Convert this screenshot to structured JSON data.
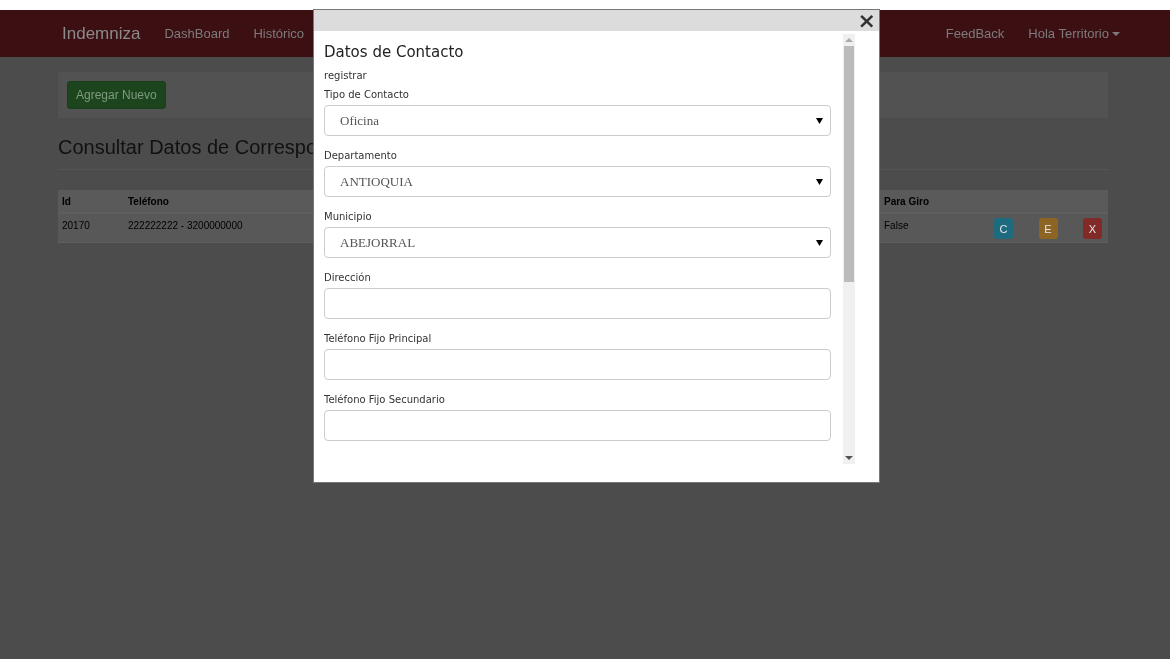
{
  "navbar": {
    "brand": "Indemniza",
    "links": [
      {
        "label": "DashBoard"
      },
      {
        "label": "Histórico"
      }
    ],
    "right_links": [
      {
        "label": "FeedBack",
        "kind": "link"
      },
      {
        "label": "Hola Territorio",
        "kind": "dropdown"
      }
    ]
  },
  "toolbar": {
    "button": "Agregar Nuevo"
  },
  "page_title": "Consultar Datos de Correspo",
  "table": {
    "columns": [
      "Id",
      "Teléfono",
      "Para Giro"
    ],
    "rows": [
      {
        "id": "20170",
        "telefono": "222222222 - 3200000000",
        "para_giro": "False",
        "actions": [
          {
            "label": "C",
            "color": "#1e6b80"
          },
          {
            "label": "E",
            "color": "#8c6424"
          },
          {
            "label": "X",
            "color": "#812a28"
          }
        ]
      }
    ]
  },
  "modal": {
    "close": "×",
    "title": "Datos de Contacto",
    "subtitle": "registrar",
    "fields": [
      {
        "kind": "select",
        "label": "Tipo de Contacto",
        "value": "Oficina"
      },
      {
        "kind": "select",
        "label": "Departamento",
        "value": "ANTIOQUIA"
      },
      {
        "kind": "select",
        "label": "Municipio",
        "value": "ABEJORRAL"
      },
      {
        "kind": "text",
        "label": "Dirección"
      },
      {
        "kind": "text",
        "label": "Teléfono Fijo Principal"
      },
      {
        "kind": "text",
        "label": "Teléfono Fijo Secundario"
      }
    ]
  }
}
